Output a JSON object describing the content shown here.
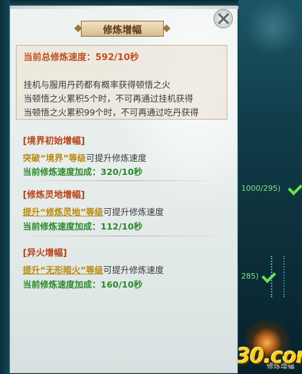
{
  "panel": {
    "title": "修炼增幅",
    "close_label": ""
  },
  "info": {
    "speed_label": "当前总修炼速度：",
    "speed_value": "592/10秒",
    "lines": [
      "挂机与服用丹药都有概率获得顿悟之火",
      "当顿悟之火累积5个时，不可再通过挂机获得",
      "当顿悟之火累积99个时，不可再通过吃丹获得"
    ]
  },
  "sections": [
    {
      "title": "[境界初始增幅]",
      "link": "突破“境界”等级",
      "suffix": "可提升修炼速度",
      "rate_label": "当前修炼速度加成：",
      "rate_value": "320/10秒"
    },
    {
      "title": "[修炼灵地增幅]",
      "link": "提升“修炼灵地”等级",
      "suffix": "可提升修炼速度",
      "rate_label": "当前修炼速度加成：",
      "rate_value": "112/10秒"
    },
    {
      "title": "[异火增幅]",
      "link": "提升“无形暗火”等级",
      "suffix": "可提升修炼速度",
      "rate_label": "当前修炼速度加成：",
      "rate_value": "160/10秒"
    }
  ],
  "background": {
    "progress_text_1": "1000/295)",
    "progress_text_2": "285)",
    "corner_label": "修炼增幅",
    "watermark": "430.com"
  },
  "colors": {
    "speed": "#c0521d",
    "section_title": "#b8431a",
    "link": "#b98a12",
    "rate": "#2d8a2d"
  }
}
